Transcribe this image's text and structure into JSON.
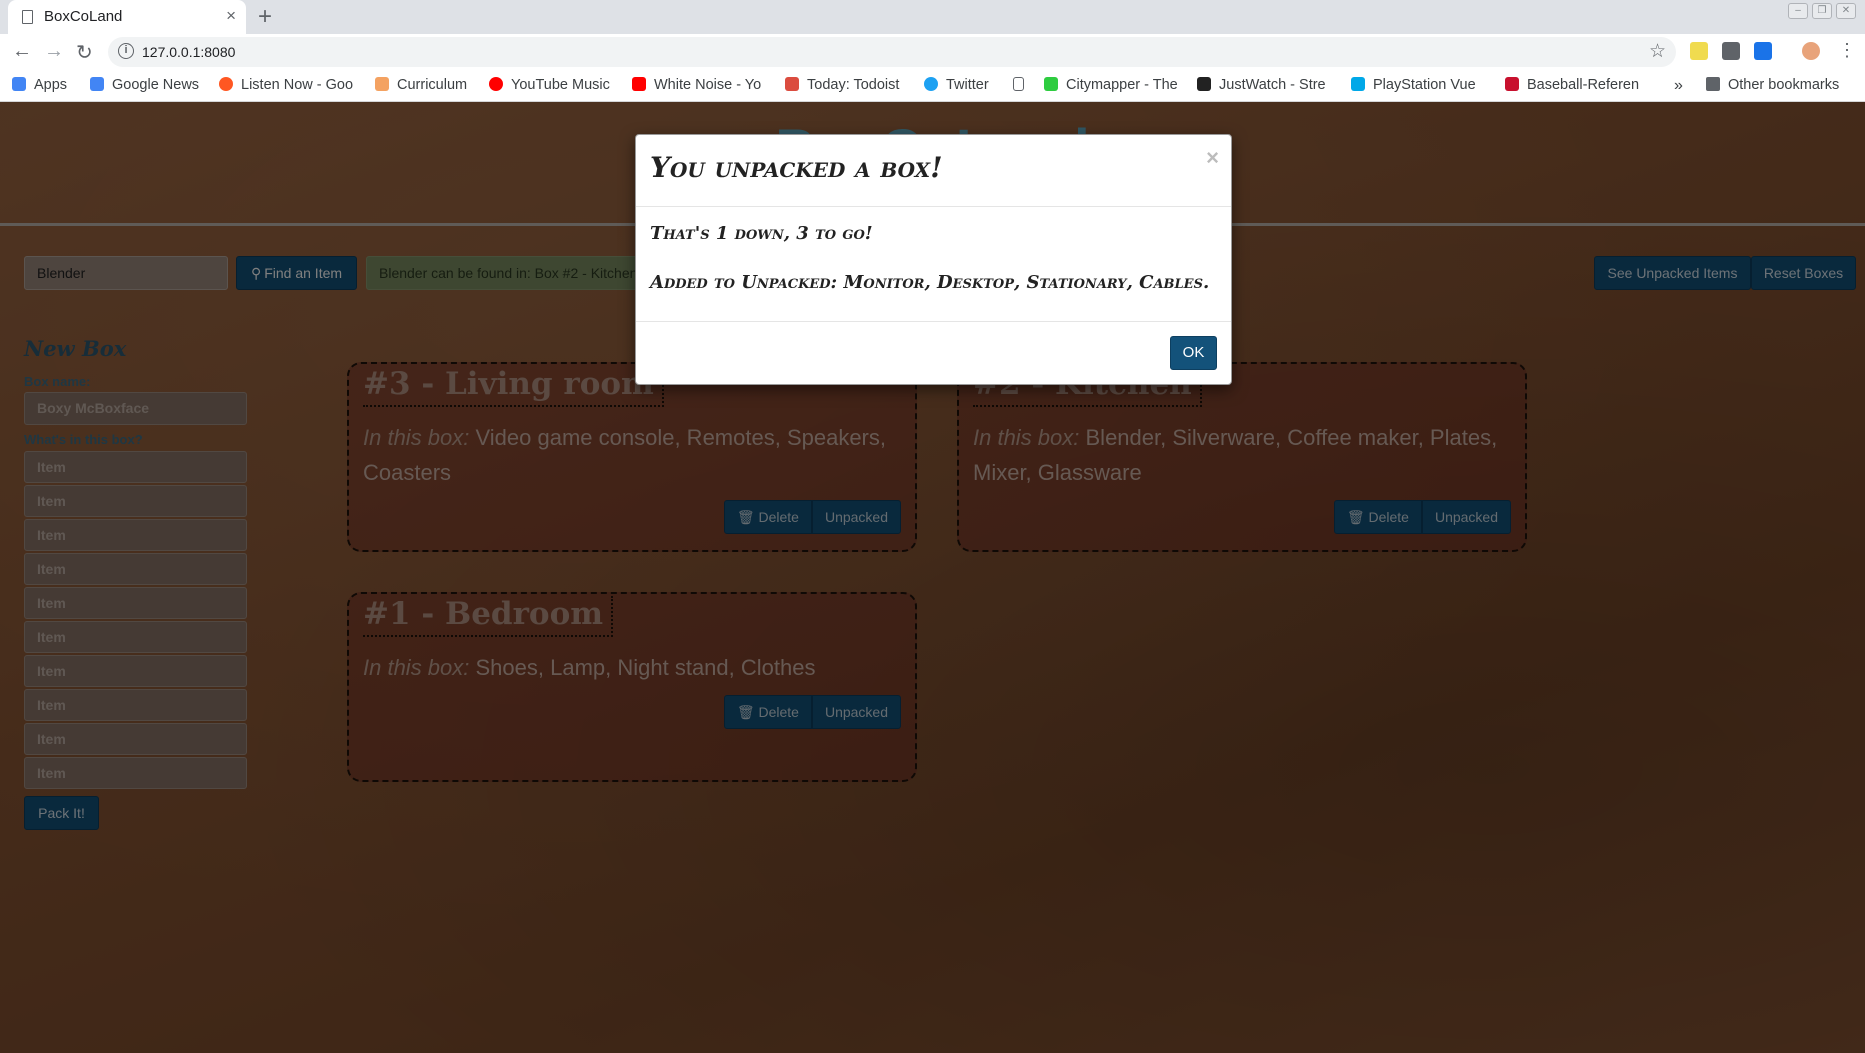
{
  "browser": {
    "tab_title": "BoxCoLand",
    "tab_close": "×",
    "new_tab": "+",
    "url": "127.0.0.1:8080",
    "bookmarks": [
      {
        "label": "Apps",
        "color": "#4285f4"
      },
      {
        "label": "Google News",
        "color": "#4285f4"
      },
      {
        "label": "Listen Now - Goo",
        "color": "#ff5722"
      },
      {
        "label": "Curriculum",
        "color": "#f4a261"
      },
      {
        "label": "YouTube Music",
        "color": "#ff0000"
      },
      {
        "label": "White Noise - Yo",
        "color": "#ff0000"
      },
      {
        "label": "Today: Todoist",
        "color": "#db4c3f"
      },
      {
        "label": "Twitter",
        "color": "#1da1f2"
      },
      {
        "label": "",
        "color": "#ffffff"
      },
      {
        "label": "Citymapper - The",
        "color": "#2ecc40"
      },
      {
        "label": "JustWatch - Stre",
        "color": "#222222"
      },
      {
        "label": "PlayStation Vue",
        "color": "#00a8e8"
      },
      {
        "label": "Baseball-Referen",
        "color": "#c8102e"
      }
    ],
    "more": "»",
    "other_bookmarks": "Other bookmarks"
  },
  "page": {
    "header_title": "BoxCoLand",
    "search_value": "Blender",
    "find_label": "Find an Item",
    "found_message": "Blender can be found in: Box #2 - Kitchen",
    "see_unpacked": "See Unpacked Items",
    "reset_boxes": "Reset Boxes"
  },
  "new_box": {
    "title": "New Box",
    "name_label": "Box name:",
    "name_placeholder": "Boxy McBoxface",
    "items_label": "What's in this box?",
    "item_placeholder": "Item",
    "pack_label": "Pack It!"
  },
  "boxes": [
    {
      "title": "#3 - Living room",
      "in_label": "In this box:",
      "contents": " Video game console, Remotes, Speakers, Coasters",
      "delete": "Delete",
      "unpacked": "Unpacked"
    },
    {
      "title": "#2 - Kitchen",
      "in_label": "In this box:",
      "contents": " Blender, Silverware, Coffee maker, Plates, Mixer, Glassware",
      "delete": "Delete",
      "unpacked": "Unpacked"
    },
    {
      "title": "#1 - Bedroom",
      "in_label": "In this box:",
      "contents": " Shoes, Lamp, Night stand, Clothes",
      "delete": "Delete",
      "unpacked": "Unpacked"
    }
  ],
  "modal": {
    "title": "You unpacked a box!",
    "close": "×",
    "line1": "That's 1 down, 3 to go!",
    "line2": "Added to Unpacked: Monitor, Desktop, Stationary, Cables.",
    "ok": "OK"
  }
}
